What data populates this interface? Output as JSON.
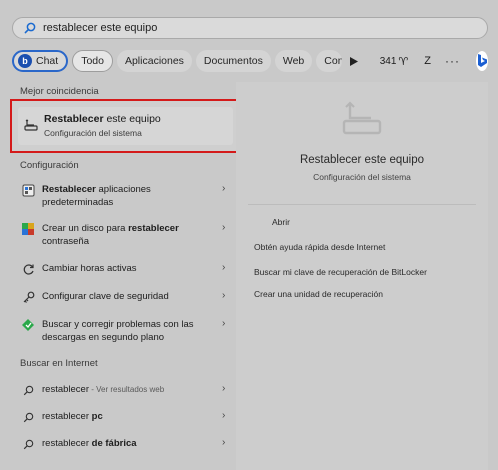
{
  "search": {
    "query": "restablecer este equipo"
  },
  "filters": {
    "chat": "Chat",
    "items": [
      "Todo",
      "Aplicaciones",
      "Documentos",
      "Web",
      "Configuración"
    ],
    "count": "341",
    "avatar_letter": "Z",
    "more": "···"
  },
  "best_match": {
    "heading": "Mejor coincidencia",
    "title_bold": "Restablecer",
    "title_rest": " este equipo",
    "subtitle": "Configuración del sistema"
  },
  "settings": {
    "heading": "Configuración",
    "items": [
      {
        "pre": "",
        "bold": "Restablecer",
        "post": " aplicaciones predeterminadas"
      },
      {
        "pre": "Crear un disco para ",
        "bold": "restablecer",
        "post": " contraseña"
      },
      {
        "pre": "Cambiar horas activas",
        "bold": "",
        "post": ""
      },
      {
        "pre": "Configurar clave de seguridad",
        "bold": "",
        "post": ""
      },
      {
        "pre": "Buscar y corregir problemas con las descargas en segundo plano",
        "bold": "",
        "post": ""
      }
    ]
  },
  "web": {
    "heading": "Buscar en Internet",
    "items": [
      {
        "pre": "restablecer",
        "bold": "",
        "muted": " - Ver resultados web"
      },
      {
        "pre": "restablecer ",
        "bold": "pc",
        "muted": ""
      },
      {
        "pre": "restablecer ",
        "bold": "de fábrica",
        "muted": ""
      }
    ]
  },
  "detail": {
    "title": "Restablecer este equipo",
    "subtitle": "Configuración del sistema",
    "actions": [
      "Abrir",
      "Obtén ayuda rápida desde Internet",
      "Buscar mi clave de recuperación de BitLocker",
      "Crear una unidad de recuperación"
    ]
  }
}
